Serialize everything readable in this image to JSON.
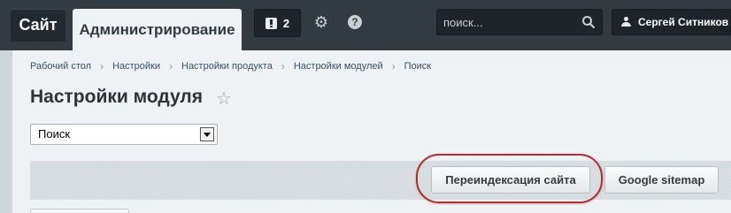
{
  "topbar": {
    "site_tab": "Сайт",
    "admin_tab": "Администрирование",
    "notifications_count": "2",
    "search_placeholder": "поиск...",
    "user_name": "Сергей Ситников",
    "icons": {
      "notifications": "notification-icon",
      "settings": "gear-icon",
      "help": "help-icon",
      "search": "search-icon",
      "user": "user-icon"
    }
  },
  "breadcrumb": [
    "Рабочий стол",
    "Настройки",
    "Настройки продукта",
    "Настройки модулей",
    "Поиск"
  ],
  "page": {
    "title": "Настройки модуля",
    "module_select_value": "Поиск"
  },
  "toolbar": {
    "reindex_label": "Переиндексация сайта",
    "sitemap_label": "Google sitemap"
  },
  "colors": {
    "topbar_bg": "#313b41",
    "content_bg": "#eef2f4",
    "highlight_ring": "#b72a2a"
  }
}
